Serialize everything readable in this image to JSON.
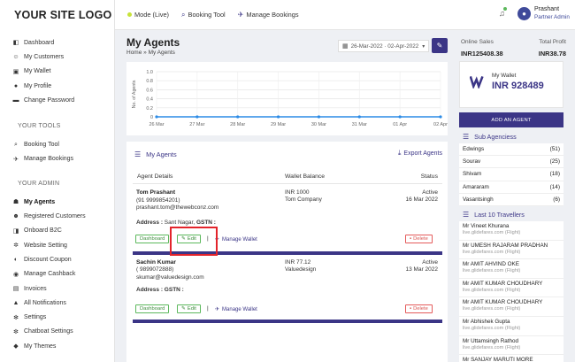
{
  "logo": "YOUR SITE LOGO",
  "sidebar": {
    "items": [
      {
        "label": "Dashboard",
        "icon": "dashboard-icon"
      },
      {
        "label": "My Customers",
        "icon": "customers-icon"
      },
      {
        "label": "My Wallet",
        "icon": "wallet-icon"
      },
      {
        "label": "My Profile",
        "icon": "profile-icon"
      },
      {
        "label": "Change Password",
        "icon": "lock-icon"
      }
    ],
    "tools_title": "YOUR TOOLS",
    "tools": [
      {
        "label": "Booking Tool",
        "icon": "search-icon"
      },
      {
        "label": "Manage Bookings",
        "icon": "plane-icon"
      }
    ],
    "admin_title": "YOUR ADMIN",
    "admin": [
      {
        "label": "My Agents",
        "icon": "users-icon"
      },
      {
        "label": "Registered Customers",
        "icon": "user-add-icon"
      },
      {
        "label": "Onboard B2C",
        "icon": "onboard-icon"
      },
      {
        "label": "Website Setting",
        "icon": "gear-icon"
      },
      {
        "label": "Discount Coupon",
        "icon": "coupon-icon"
      },
      {
        "label": "Manage Cashback",
        "icon": "cashback-icon"
      },
      {
        "label": "Invoices",
        "icon": "invoice-icon"
      },
      {
        "label": "All Notifications",
        "icon": "bell-icon"
      },
      {
        "label": "Settings",
        "icon": "gear-icon"
      },
      {
        "label": "Chatboat Settings",
        "icon": "chat-icon"
      },
      {
        "label": "My Themes",
        "icon": "theme-icon"
      }
    ]
  },
  "topbar": {
    "mode": "Mode (Live)",
    "booking_tool": "Booking Tool",
    "manage_bookings": "Manage Bookings",
    "user_name": "Prashant",
    "user_role": "Partner Admin"
  },
  "page": {
    "title": "My Agents",
    "breadcrumb": "Home » My Agents",
    "date_range": "26-Mar-2022 · 02-Apr-2022"
  },
  "chart_data": {
    "type": "line",
    "ylabel": "No. of Agents",
    "ylim": [
      0,
      1.0
    ],
    "yticks": [
      "1.0",
      "0.8",
      "0.6",
      "0.4",
      "0.2",
      "0"
    ],
    "categories": [
      "26 Mar",
      "27 Mar",
      "28 Mar",
      "29 Mar",
      "30 Mar",
      "31 Mar",
      "01 Apr",
      "02 Apr"
    ],
    "series": [
      {
        "values": [
          0,
          0,
          0,
          0,
          0,
          0,
          0,
          0
        ],
        "color": "#2b8be6"
      }
    ]
  },
  "agents_section": {
    "title": "My Agents",
    "export": "Export Agents",
    "col_details": "Agent Details",
    "col_wallet": "Wallet Balance",
    "col_status": "Status",
    "rows": [
      {
        "name": "Tom Prashant",
        "phone": "(91 9999854201)",
        "email": "prashant.tom@thewebconz.com",
        "wallet": "INR 1000",
        "company": "Tom Company",
        "status": "Active",
        "date": "16 Mar 2022",
        "address_label": "Address :",
        "address": "Sant Nagar,",
        "gstn_label": "GSTN :"
      },
      {
        "name": "Sachin Kumar",
        "phone": "( 9899072888)",
        "email": "skumar@valuedesign.com",
        "wallet": "INR 77.12",
        "company": "Valuedesign",
        "status": "Active",
        "date": "13 Mar 2022",
        "address_label": "Address :",
        "address": "Saket,",
        "gstn_label": "GSTN :"
      }
    ],
    "btn_dashboard": "Dashboard",
    "btn_edit": "Edit",
    "btn_manage": "Manage Wallet",
    "btn_delete": "Delete",
    "pipe": "|"
  },
  "right": {
    "online_label": "Online Sales",
    "profit_label": "Total Profit",
    "online_val": "INR125408.38",
    "profit_val": "INR38.78",
    "wallet_label": "My Wallet",
    "wallet_val": "INR 928489",
    "add_agent": "ADD AN AGENT",
    "sub_title": "Sub Agenciess",
    "sub_agencies": [
      {
        "name": "Edwings",
        "count": "(51)"
      },
      {
        "name": "Sourav",
        "count": "(25)"
      },
      {
        "name": "Shivam",
        "count": "(18)"
      },
      {
        "name": "Amararam",
        "count": "(14)"
      },
      {
        "name": "Vasantsingh",
        "count": "(6)"
      }
    ],
    "trav_title": "Last 10 Travellers",
    "travellers": [
      {
        "name": "Mr Vineet Khurana",
        "sub": "live.glidefares.com (Flight)"
      },
      {
        "name": "Mr UMESH RAJARAM PRADHAN",
        "sub": "live.glidefares.com (Flight)"
      },
      {
        "name": "Mr AMIT AHVIND OKE",
        "sub": "live.glidefares.com (Flight)"
      },
      {
        "name": "Mr AMIT KUMAR CHOUDHARY",
        "sub": "live.glidefares.com (Flight)"
      },
      {
        "name": "Mr AMIT KUMAR CHOUDHARY",
        "sub": "live.glidefares.com (Flight)"
      },
      {
        "name": "Mr Abhishek Gupta",
        "sub": "live.glidefares.com (Flight)"
      },
      {
        "name": "Mr Uttamsingh Rathod",
        "sub": "live.glidefares.com (Flight)"
      },
      {
        "name": "Mr SANJAY MARUTI MORE",
        "sub": ""
      }
    ]
  }
}
